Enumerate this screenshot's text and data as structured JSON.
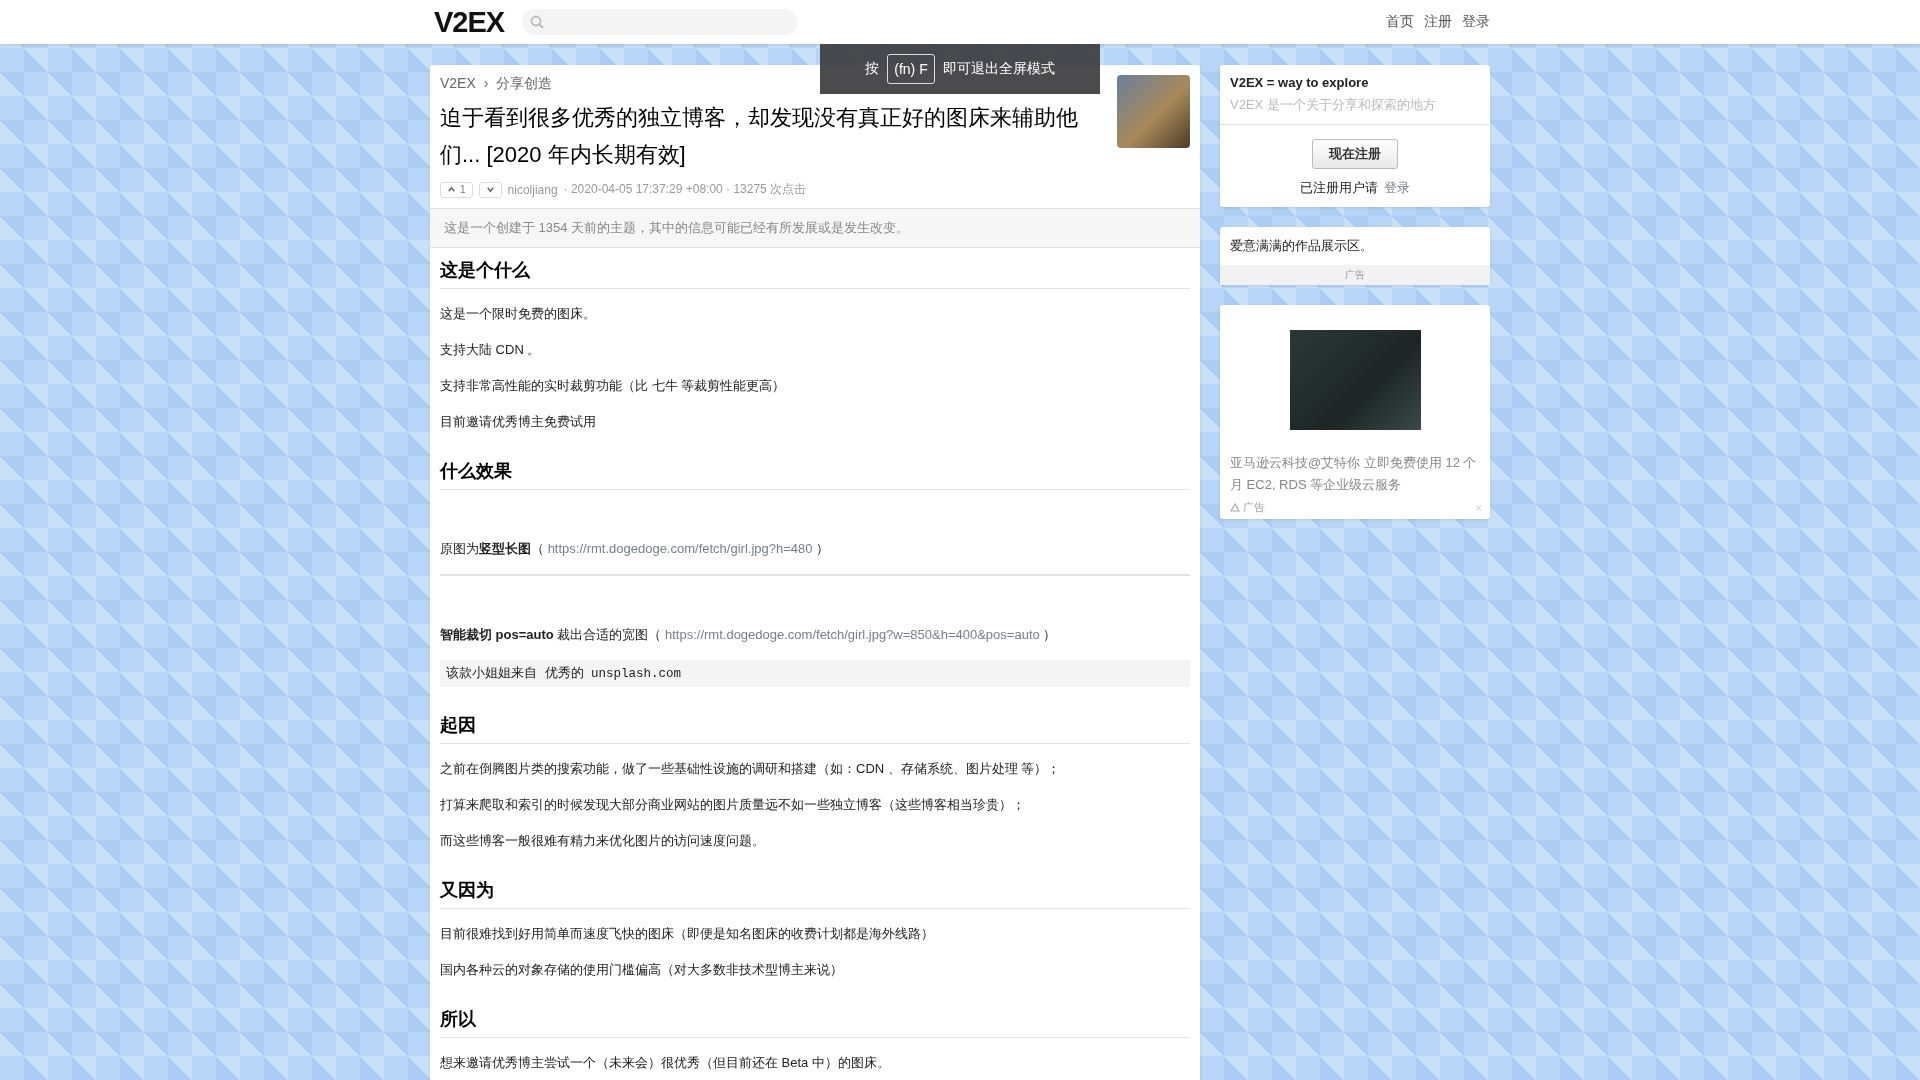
{
  "header": {
    "logo": "V2EX",
    "nav": [
      "首页",
      "注册",
      "登录"
    ]
  },
  "toast": {
    "prefix": "按",
    "key": "(fn) F",
    "suffix": "即可退出全屏模式"
  },
  "topic": {
    "breadcrumb": [
      "V2EX",
      "分享创造"
    ],
    "separator": "›",
    "title": "迫于看到很多优秀的独立博客，却发现没有真正好的图床来辅助他们... [2020 年内长期有效]",
    "upvotes": "1",
    "author": "nicoljiang",
    "meta": "· 2020-04-05 17:37:29 +08:00 · 13275 次点击",
    "notice": "这是一个创建于 1354 天前的主题，其中的信息可能已经有所发展或是发生改变。"
  },
  "content": [
    {
      "kind": "heading",
      "text": "这是个什么"
    },
    {
      "kind": "paragraph",
      "text": "这是一个限时免费的图床。"
    },
    {
      "kind": "paragraph",
      "text": "支持大陆 CDN 。"
    },
    {
      "kind": "paragraph",
      "text": "支持非常高性能的实时裁剪功能（比 七牛 等裁剪性能更高）"
    },
    {
      "kind": "paragraph",
      "text": "目前邀请优秀博主免费试用"
    },
    {
      "kind": "heading",
      "text": "什么效果"
    },
    {
      "kind": "caption",
      "text": "原图为**竖型长图**（ ",
      "link": "https://rmt.dogedoge.com/fetch/girl.jpg?h=480",
      "after": " ）"
    },
    {
      "kind": "rule"
    },
    {
      "kind": "caption",
      "text": "**智能裁切 pos=auto** 裁出合适的宽图（ ",
      "link": "https://rmt.dogedoge.com/fetch/girl.jpg?w=850&h=400&pos=auto",
      "after": " ）"
    },
    {
      "kind": "code",
      "text": "该款小姐姐来自 优秀的 unsplash.com"
    },
    {
      "kind": "heading",
      "text": "起因"
    },
    {
      "kind": "paragraph",
      "text": "之前在倒腾图片类的搜索功能，做了一些基础性设施的调研和搭建（如：CDN 、存储系统、图片处理 等）；"
    },
    {
      "kind": "paragraph",
      "text": "打算来爬取和索引的时候发现大部分商业网站的图片质量远不如一些独立博客（这些博客相当珍贵）；"
    },
    {
      "kind": "paragraph",
      "text": "而这些博客一般很难有精力来优化图片的访问速度问题。"
    },
    {
      "kind": "heading",
      "text": "又因为"
    },
    {
      "kind": "paragraph",
      "text": "目前很难找到好用简单而速度飞快的图床（即便是知名图床的收费计划都是海外线路）"
    },
    {
      "kind": "paragraph",
      "text": "国内各种云的对象存储的使用门槛偏高（对大多数非技术型博主来说）"
    },
    {
      "kind": "heading",
      "text": "所以"
    },
    {
      "kind": "paragraph",
      "text": "想来邀请优秀博主尝试一个（未来会）很优秀（但目前还在 Beta 中）的图床。"
    }
  ],
  "sidebar": {
    "welcome": {
      "title": "V2EX = way to explore",
      "subtitle": "V2EX 是一个关于分享和探索的地方",
      "register": "现在注册",
      "login_prompt": "已注册用户请",
      "login": "登录"
    },
    "promo": {
      "text": "爱意满满的作品展示区。",
      "footer": "广告"
    },
    "ad": {
      "text": "亚马逊云科技@艾特你 立即免费使用 12 个月 EC2, RDS 等企业级云服务",
      "label": "广告",
      "close": "×"
    }
  }
}
